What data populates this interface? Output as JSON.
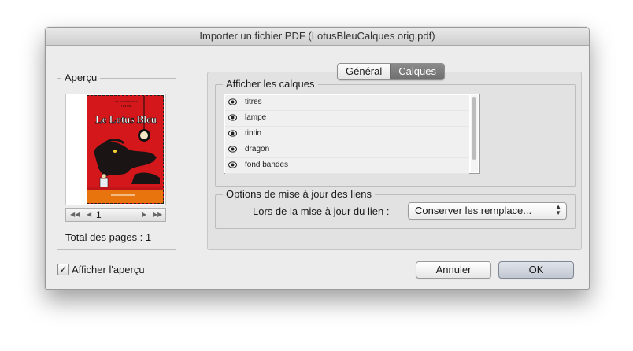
{
  "window": {
    "title": "Importer un fichier PDF (LotusBleuCalques orig.pdf)"
  },
  "preview": {
    "group_label": "Aperçu",
    "cover_title": "Le Lotus Bleu",
    "cover_top_text": "LES AVENTURES DE",
    "cover_hero": "TINTIN",
    "page_number": "1",
    "total_pages": "Total des pages : 1",
    "show_preview_label": "Afficher l'aperçu",
    "show_preview_checked": true
  },
  "tabs": [
    {
      "label": "Général",
      "active": false
    },
    {
      "label": "Calques",
      "active": true
    }
  ],
  "layers": {
    "group_label": "Afficher les calques",
    "items": [
      {
        "name": "titres",
        "visible": true
      },
      {
        "name": "lampe",
        "visible": true
      },
      {
        "name": "tintin",
        "visible": true
      },
      {
        "name": "dragon",
        "visible": true
      },
      {
        "name": "fond bandes",
        "visible": true
      }
    ]
  },
  "links": {
    "group_label": "Options de mise à jour des liens",
    "update_label": "Lors de la mise à jour du lien :",
    "update_value": "Conserver les remplace..."
  },
  "buttons": {
    "cancel": "Annuler",
    "ok": "OK"
  },
  "colors": {
    "accent_tab": "#7b7b7b",
    "cover_red": "#d4171b"
  }
}
